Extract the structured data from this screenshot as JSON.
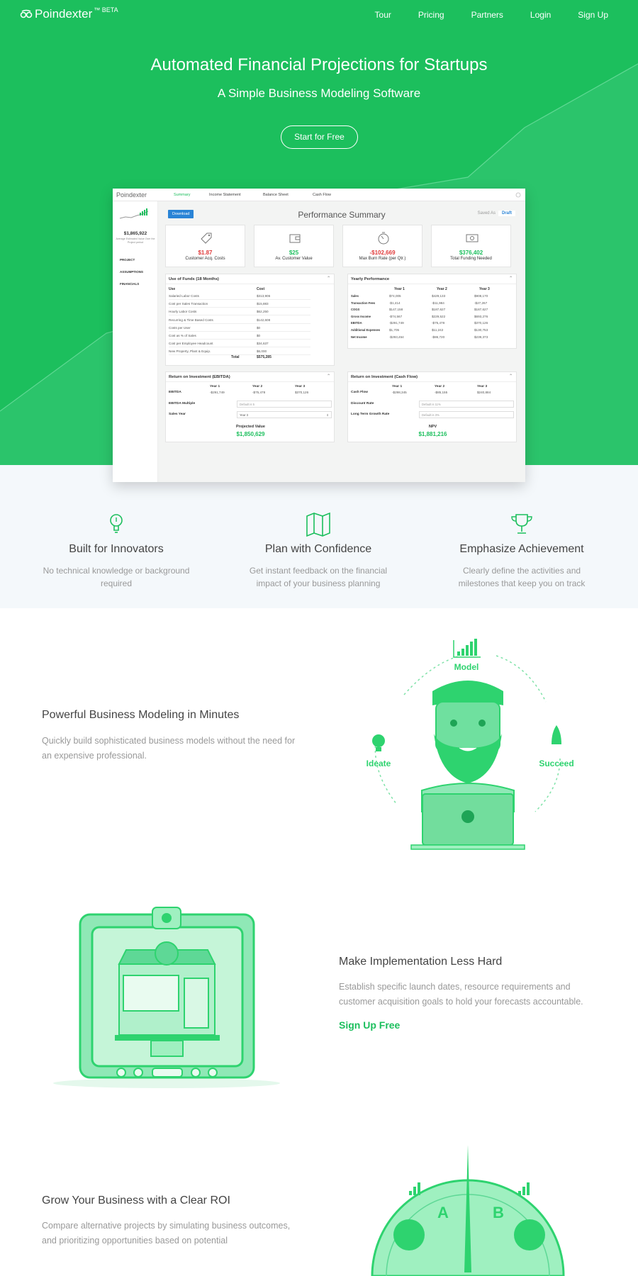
{
  "brand": {
    "name": "Poindexter",
    "tag": "™ BETA"
  },
  "nav": {
    "items": [
      "Tour",
      "Pricing",
      "Partners",
      "Login",
      "Sign Up"
    ]
  },
  "hero": {
    "title": "Automated Financial Projections for Startups",
    "subtitle": "A Simple Business Modeling Software",
    "cta": "Start for Free"
  },
  "app": {
    "brand": "Poindexter",
    "tabs": [
      "Summary",
      "Income Statement",
      "Balance Sheet",
      "Cash Flow"
    ],
    "sidebar": {
      "value": "$1,865,922",
      "caption": "Average Estimated Value Over the Project period",
      "items": [
        "PROJECT",
        "ASSUMPTIONS",
        "FINANCIALS"
      ]
    },
    "download": "Download",
    "page_title": "Performance Summary",
    "saved_as": "Saved As",
    "draft": "Draft",
    "kpis": [
      {
        "value": "$1.87",
        "label": "Customer Acq. Costs",
        "color": "#e03b3b",
        "icon": "tag-icon"
      },
      {
        "value": "$25",
        "label": "Av. Customer Value",
        "color": "#1cbf5d",
        "icon": "wallet-icon"
      },
      {
        "value": "-$102,669",
        "label": "Max Burn Rate (per Qtr.)",
        "color": "#e03b3b",
        "icon": "stopwatch-icon"
      },
      {
        "value": "$376,402",
        "label": "Total Funding Needed",
        "color": "#1cbf5d",
        "icon": "cash-icon"
      }
    ],
    "use_of_funds": {
      "title": "Use of Funds (18 Months)",
      "headers": [
        "Use",
        "Cost"
      ],
      "rows": [
        [
          "Salaried Labor Costs",
          "$313,906"
        ],
        [
          "Cost per Sales Transaction",
          "$15,883"
        ],
        [
          "Hourly Labor Costs",
          "$62,250"
        ],
        [
          "Recurring & Time Based Costs",
          "$142,608"
        ],
        [
          "Costs per User",
          "$0"
        ],
        [
          "Cost as % of Sales",
          "$0"
        ],
        [
          "Cost per Employee Headcount",
          "$34,637"
        ],
        [
          "New Property, Plant & Equip.",
          "$6,000"
        ]
      ],
      "total_label": "Total",
      "total": "$575,285"
    },
    "yearly": {
      "title": "Yearly Performance",
      "headers": [
        "Year 1",
        "Year 2",
        "Year 3"
      ],
      "rows": [
        [
          "Sales",
          "$74,005",
          "$429,133",
          "$908,170"
        ],
        [
          "Transaction Fees",
          "-$1,414",
          "-$11,984",
          "-$27,267"
        ],
        [
          "COGS",
          "$147,158",
          "$187,627",
          "$187,627"
        ],
        [
          "Gross Income",
          "-$74,567",
          "$229,522",
          "$693,276"
        ],
        [
          "EBITDA",
          "-$291,749",
          "-$75,478",
          "$370,126"
        ],
        [
          "Additional Expenses",
          "$1,705",
          "$11,242",
          "$130,753"
        ],
        [
          "Net Income",
          "-$293,454",
          "-$86,720",
          "$239,373"
        ]
      ]
    },
    "roi_ebitda": {
      "title": "Return on Investment (EBITDA)",
      "headers": [
        "Year 1",
        "Year 2",
        "Year 3"
      ],
      "row_label": "EBITDA",
      "values": [
        "-$291,749",
        "-$75,478",
        "$370,126"
      ],
      "multiple_label": "EBITDA Multiple",
      "multiple_placeholder": "Default is 5",
      "sales_year_label": "Sales Year",
      "sales_year_value": "Year 3",
      "projected_label": "Projected Value",
      "projected_value": "$1,850,629"
    },
    "roi_cash": {
      "title": "Return on Investment (Cash Flow)",
      "headers": [
        "Year 1",
        "Year 2",
        "Year 3"
      ],
      "row_label": "Cash Flow",
      "values": [
        "-$298,345",
        "-$85,155",
        "$240,884"
      ],
      "discount_label": "Discount Rate",
      "discount_placeholder": "Default is 11%",
      "growth_label": "Long Term Growth Rate",
      "growth_placeholder": "Default is 3%",
      "npv_label": "NPV",
      "npv_value": "$1,881,216"
    }
  },
  "features": [
    {
      "title": "Built for Innovators",
      "desc": "No technical knowledge or background required",
      "icon": "lightbulb-icon"
    },
    {
      "title": "Plan with Confidence",
      "desc": "Get instant feedback on the financial impact of your business planning",
      "icon": "map-icon"
    },
    {
      "title": "Emphasize Achievement",
      "desc": "Clearly define the activities and milestones that keep you on track",
      "icon": "trophy-icon"
    }
  ],
  "section1": {
    "title": "Powerful Business Modeling in Minutes",
    "desc": "Quickly build sophisticated business models without the need for an expensive professional.",
    "cycle": [
      "Model",
      "Ideate",
      "Succeed"
    ]
  },
  "section2": {
    "title": "Make Implementation Less Hard",
    "desc": "Establish specific launch dates, resource requirements and customer acquisition goals to hold your forecasts accountable.",
    "link": "Sign Up Free"
  },
  "section3": {
    "title": "Grow Your Business with a Clear ROI",
    "desc": "Compare alternative projects by simulating business outcomes, and prioritizing opportunities based on potential",
    "dial": [
      "A",
      "B"
    ]
  },
  "colors": {
    "brand": "#1cbf5d",
    "accent_blue": "#2a84d6",
    "negative": "#e03b3b"
  }
}
